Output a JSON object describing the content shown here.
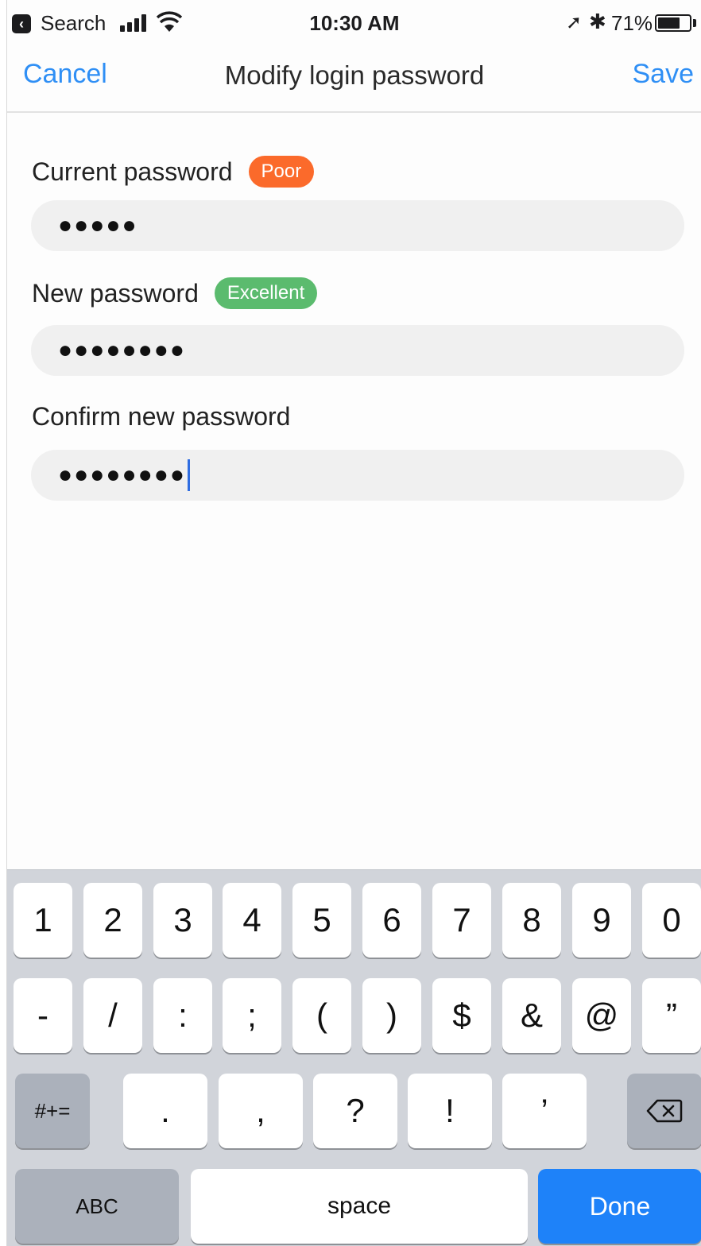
{
  "status_bar": {
    "back_app": "Search",
    "time": "10:30 AM",
    "battery_percent": "71%",
    "battery_level": 0.71,
    "icons": [
      "back-app-icon",
      "cellular-signal-icon",
      "wifi-icon",
      "location-arrow-icon",
      "bluetooth-icon",
      "battery-icon"
    ]
  },
  "nav": {
    "cancel_label": "Cancel",
    "title": "Modify login password",
    "save_label": "Save",
    "accent_color": "#2f8ff5"
  },
  "form": {
    "current": {
      "label": "Current password",
      "strength": "Poor",
      "strength_color": "#fb6a2b",
      "masked_value": "●●●●●"
    },
    "new": {
      "label": "New password",
      "strength": "Excellent",
      "strength_color": "#5bbb6e",
      "masked_value": "●●●●●●●●"
    },
    "confirm": {
      "label": "Confirm new password",
      "masked_value": "●●●●●●●●"
    }
  },
  "keyboard": {
    "row1": [
      "1",
      "2",
      "3",
      "4",
      "5",
      "6",
      "7",
      "8",
      "9",
      "0"
    ],
    "row2": [
      "-",
      "/",
      ":",
      ";",
      "(",
      ")",
      "$",
      "&",
      "@",
      "”"
    ],
    "row3_left": "#+=",
    "row3": [
      ".",
      ",",
      "?",
      "!",
      "’"
    ],
    "abc_label": "ABC",
    "space_label": "space",
    "done_label": "Done",
    "done_color": "#1e82f9"
  }
}
